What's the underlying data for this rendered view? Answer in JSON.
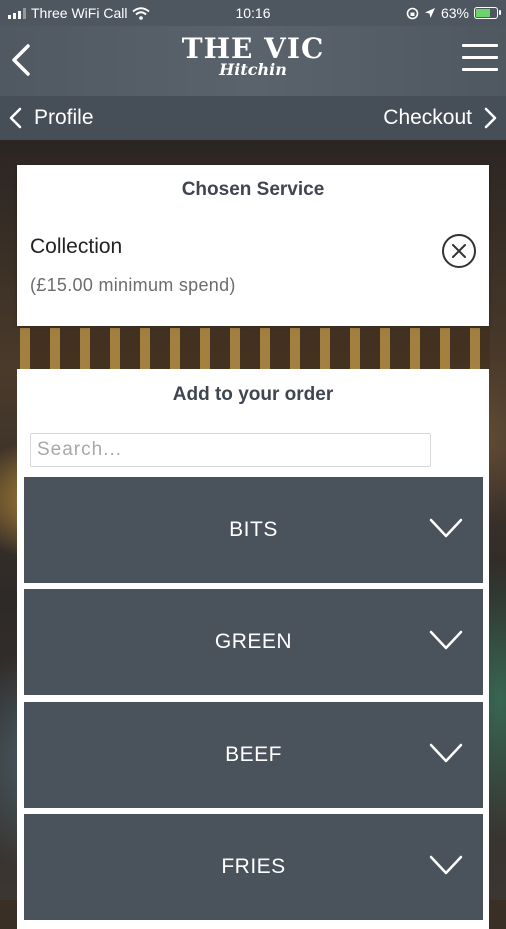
{
  "status": {
    "carrier": "Three WiFi Call",
    "time": "10:16",
    "battery": "63%",
    "battery_level": 0.63
  },
  "header": {
    "logo_name": "THE VIC",
    "logo_sub": "Hitchin"
  },
  "subnav": {
    "prev_label": "Profile",
    "next_label": "Checkout"
  },
  "service": {
    "title": "Chosen Service",
    "name": "Collection",
    "min_spend": "(£15.00 minimum spend)"
  },
  "order": {
    "title": "Add to your order",
    "search_placeholder": "Search...",
    "categories": [
      {
        "label": "BITS"
      },
      {
        "label": "GREEN"
      },
      {
        "label": "BEEF"
      },
      {
        "label": "FRIES"
      }
    ]
  },
  "colors": {
    "header": "#505862",
    "category_bg": "#4a525c",
    "battery_green": "#6cd36a"
  }
}
